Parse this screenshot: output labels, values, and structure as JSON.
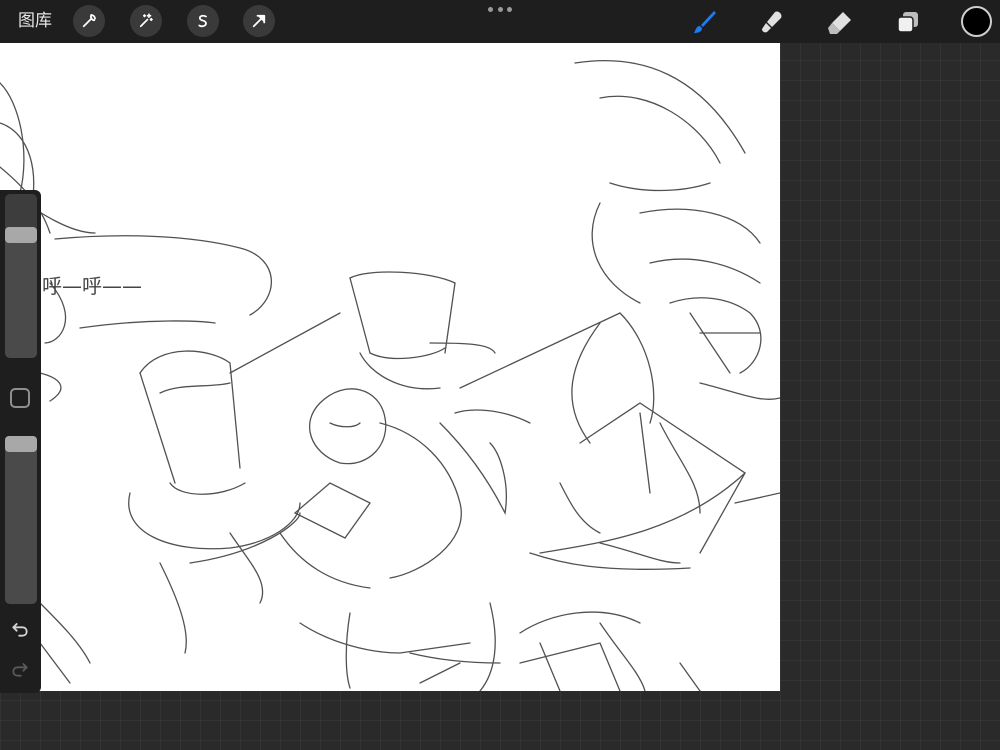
{
  "toolbar": {
    "gallery_label": "图库",
    "actions": [
      {
        "name": "actions-wrench",
        "icon": "wrench-icon"
      },
      {
        "name": "adjustments-wand",
        "icon": "magic-wand-icon"
      },
      {
        "name": "selection",
        "icon": "selection-s-icon"
      },
      {
        "name": "transform",
        "icon": "transform-arrow-icon"
      }
    ],
    "more_icon": "more-dots-icon",
    "tools": [
      {
        "name": "brush",
        "icon": "brush-icon",
        "active": true
      },
      {
        "name": "smudge",
        "icon": "smudge-icon",
        "active": false
      },
      {
        "name": "eraser",
        "icon": "eraser-icon",
        "active": false
      },
      {
        "name": "layers",
        "icon": "layers-icon",
        "active": false
      }
    ],
    "current_color": "#000000",
    "active_color": "#1e7bf2"
  },
  "canvas": {
    "handwritten_text": "呼—呼——"
  },
  "sidebar": {
    "brush_size_level": 0.78,
    "opacity_level": 1.0,
    "modify_icon": "square-modify-icon",
    "undo_icon": "undo-icon",
    "redo_icon": "redo-icon"
  }
}
